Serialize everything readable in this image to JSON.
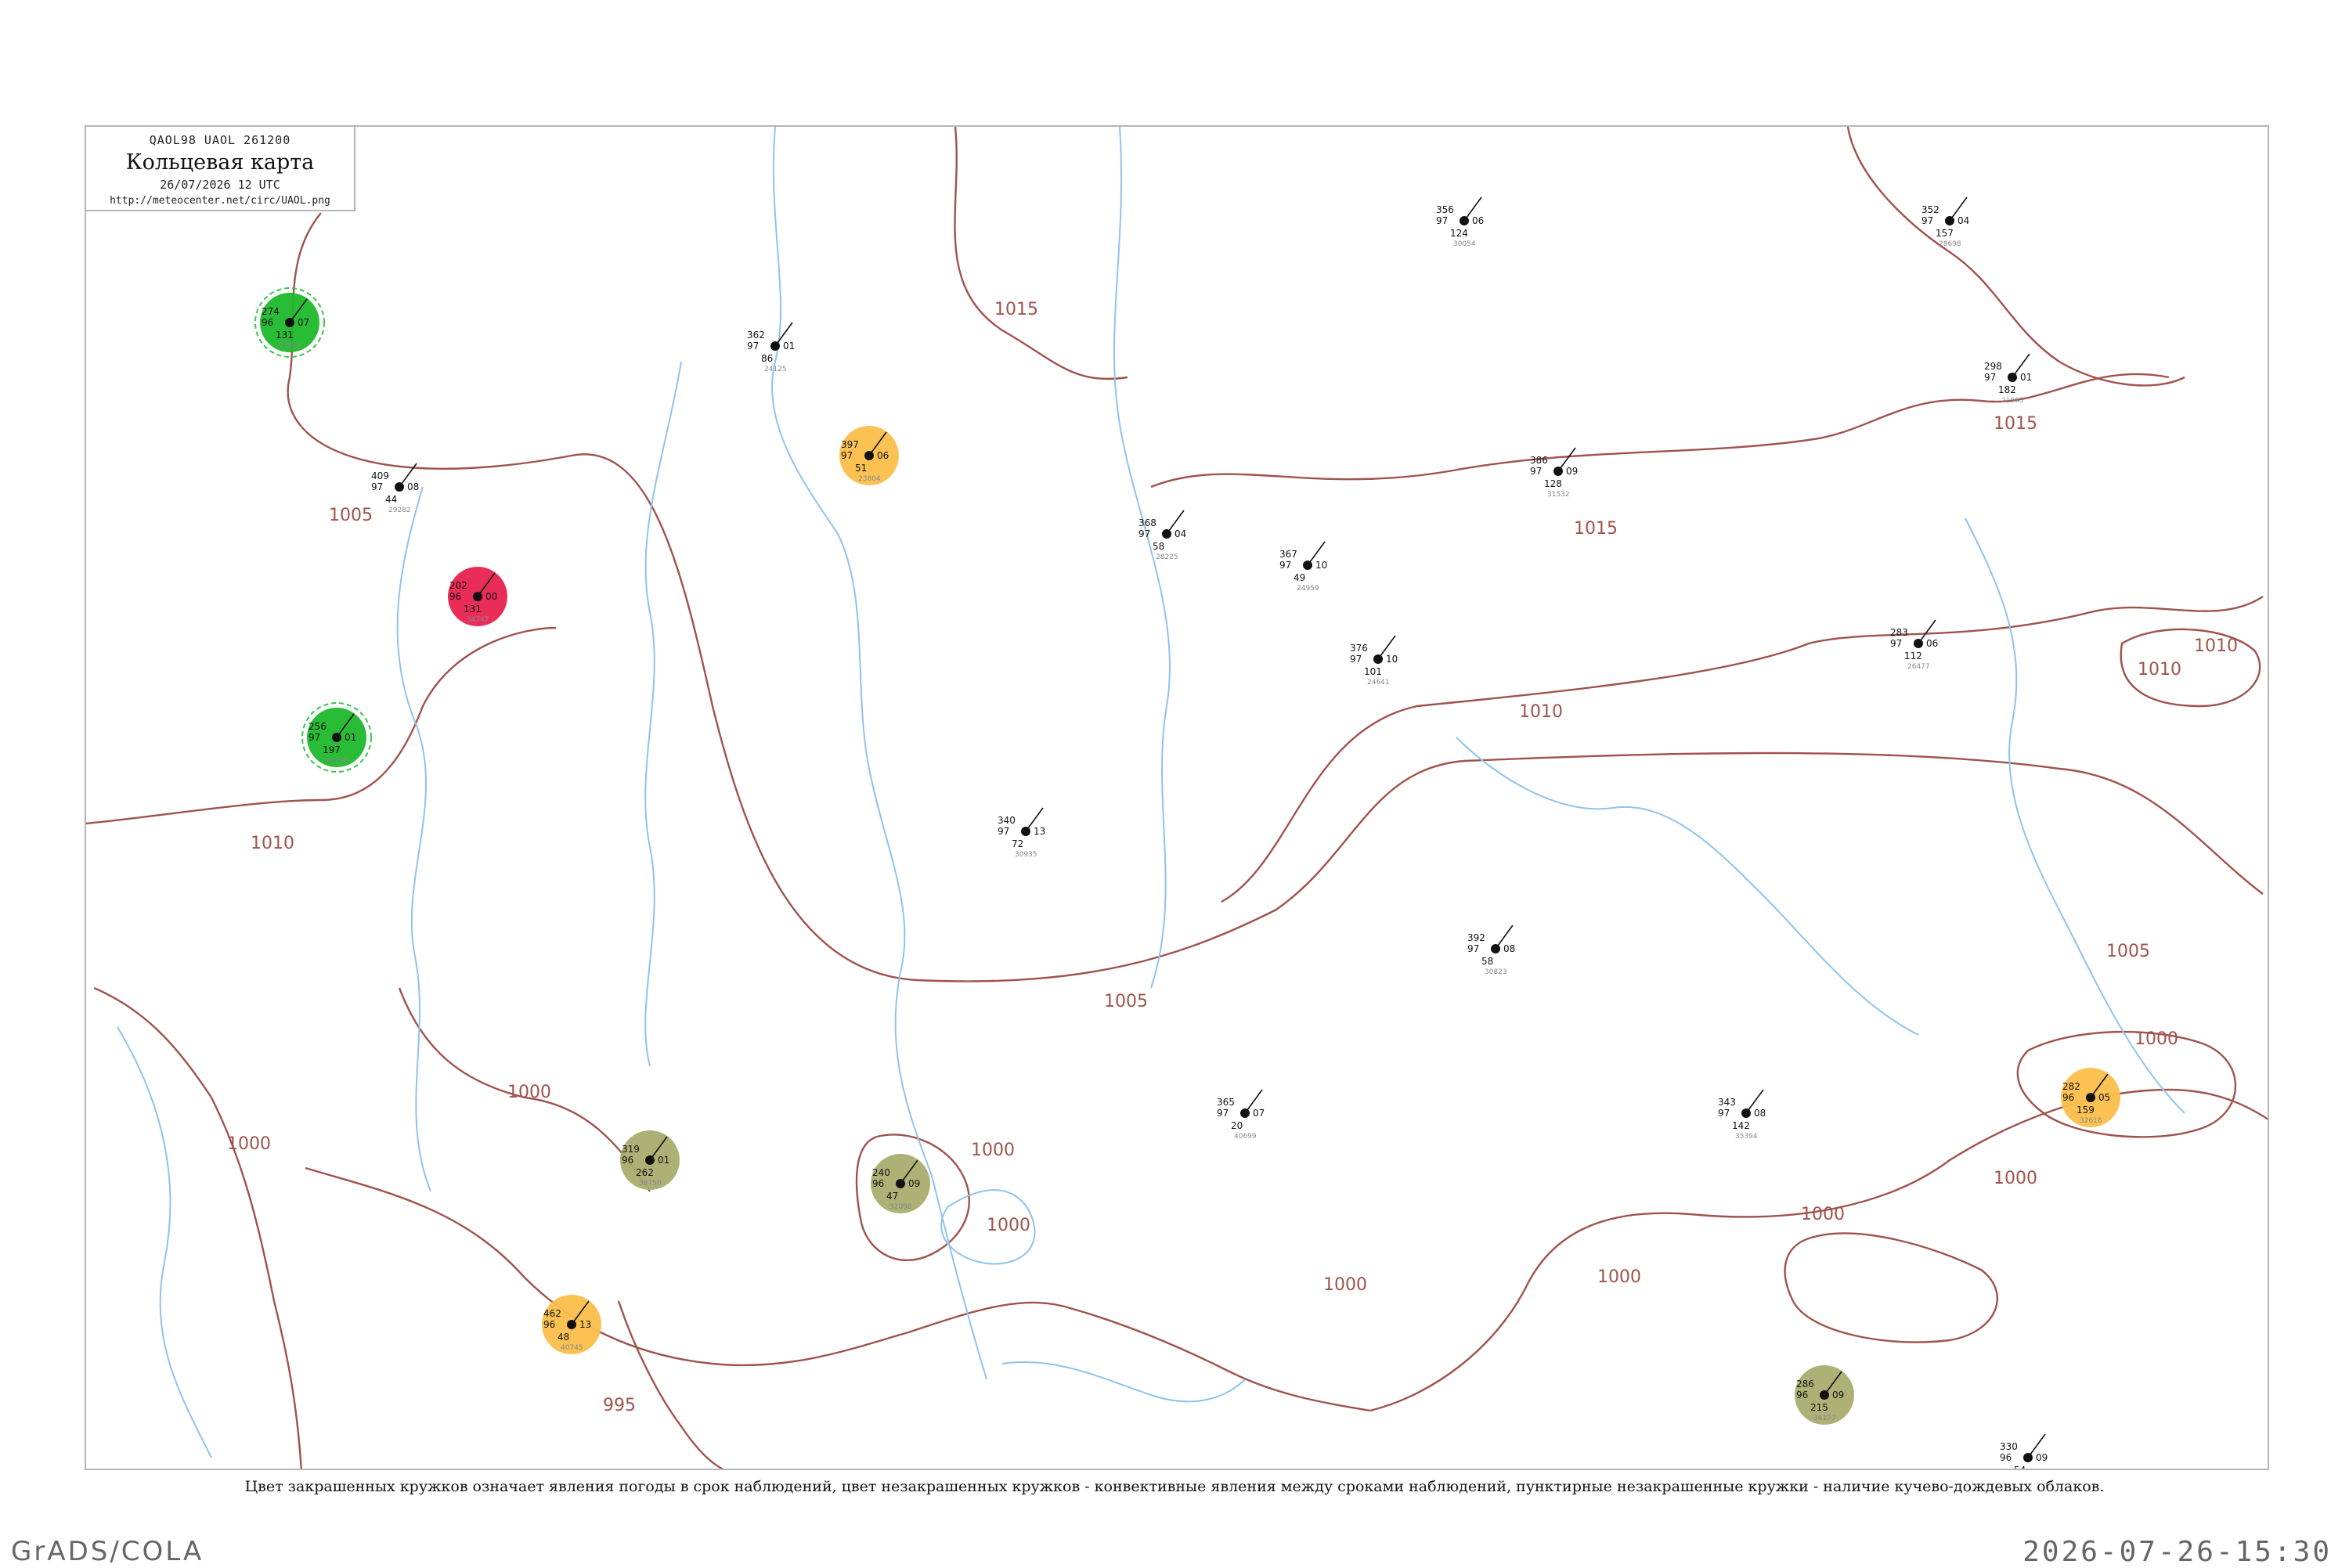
{
  "header": {
    "codes": "QAOL98  UAOL  261200",
    "title": "Кольцевая карта",
    "datetime": "26/07/2026 12 UTC",
    "url": "http://meteocenter.net/circ/UAOL.png"
  },
  "isobar_labels": {
    "label_995": "995",
    "label_1000": "1000",
    "label_1005": "1005",
    "label_1010": "1010",
    "label_1015": "1015"
  },
  "colors": {
    "isobar": "#a0524d",
    "river": "#8ec3ee",
    "circle_green": "#1db82b",
    "circle_red": "#e8224f",
    "circle_orange": "#fbbf4a",
    "circle_olive": "#a9ad6e",
    "circle_yellow": "#f2ef6a",
    "ring_green_dashed": "#34c74a",
    "ring_magenta": "#d43a86"
  },
  "map": {
    "stations": [
      {
        "id": "28225",
        "pressure": "368",
        "temp": "97",
        "value2": "04",
        "value3": "58",
        "highlight": "none"
      },
      {
        "id": "23804",
        "pressure": "397",
        "temp": "97",
        "value2": "06",
        "value3": "51",
        "highlight": "orange"
      },
      {
        "id": "24125",
        "pressure": "362",
        "temp": "97",
        "value2": "01",
        "value3": "86",
        "highlight": "none"
      },
      {
        "id": "30054",
        "pressure": "356",
        "temp": "97",
        "value2": "06",
        "value3": "124",
        "highlight": "none"
      },
      {
        "id": "29282",
        "pressure": "409",
        "temp": "97",
        "value2": "08",
        "value3": "44",
        "highlight": "none"
      },
      {
        "id": "31532",
        "pressure": "386",
        "temp": "97",
        "value2": "09",
        "value3": "128",
        "highlight": "none"
      },
      {
        "id": "28698",
        "pressure": "352",
        "temp": "97",
        "value2": "04",
        "value3": "157",
        "highlight": "none"
      },
      {
        "id": "32098",
        "pressure": "240",
        "temp": "96",
        "value2": "09",
        "value3": "47",
        "highlight": "olive"
      },
      {
        "id": "34747",
        "pressure": "202",
        "temp": "96",
        "value2": "00",
        "value3": "131",
        "highlight": "red"
      },
      {
        "id": "27612",
        "pressure": "274",
        "temp": "96",
        "value2": "07",
        "value3": "131",
        "highlight": "green"
      },
      {
        "id": "26477",
        "pressure": "283",
        "temp": "97",
        "value2": "06",
        "value3": "112",
        "highlight": "none"
      },
      {
        "id": "40745",
        "pressure": "462",
        "temp": "96",
        "value2": "13",
        "value3": "48",
        "highlight": "orange"
      },
      {
        "id": "38750",
        "pressure": "319",
        "temp": "96",
        "value2": "01",
        "value3": "262",
        "highlight": "olive"
      },
      {
        "id": "30935",
        "pressure": "340",
        "temp": "97",
        "value2": "13",
        "value3": "72",
        "highlight": "none"
      },
      {
        "id": "21965",
        "pressure": "298",
        "temp": "97",
        "value2": "01",
        "value3": "182",
        "highlight": "none"
      },
      {
        "id": "35746",
        "pressure": "330",
        "temp": "96",
        "value2": "09",
        "value3": "54",
        "highlight": "none"
      },
      {
        "id": "24959",
        "pressure": "367",
        "temp": "97",
        "value2": "10",
        "value3": "49",
        "highlight": "none"
      },
      {
        "id": "30823",
        "pressure": "392",
        "temp": "97",
        "value2": "08",
        "value3": "58",
        "highlight": "none"
      },
      {
        "id": "40699",
        "pressure": "365",
        "temp": "97",
        "value2": "07",
        "value3": "20",
        "highlight": "none"
      },
      {
        "id": "36177",
        "pressure": "286",
        "temp": "96",
        "value2": "09",
        "value3": "215",
        "highlight": "olive"
      },
      {
        "id": "26298",
        "pressure": "256",
        "temp": "97",
        "value2": "01",
        "value3": "197",
        "highlight": "green"
      },
      {
        "id": "24641",
        "pressure": "376",
        "temp": "97",
        "value2": "10",
        "value3": "101",
        "highlight": "none"
      },
      {
        "id": "35394",
        "pressure": "343",
        "temp": "97",
        "value2": "08",
        "value3": "142",
        "highlight": "none"
      },
      {
        "id": "32618",
        "pressure": "282",
        "temp": "96",
        "value2": "05",
        "value3": "159",
        "highlight": "orange"
      }
    ]
  },
  "legend_note": "Цвет закрашенных кружков означает явления погоды в срок наблюдений, цвет незакрашенных кружков - конвективные явления между сроками наблюдений, пунктирные незакрашенные кружки - наличие кучево-дождевых облаков.",
  "footer": {
    "brand": "GrADS/COLA",
    "timestamp": "2026-07-26-15:30"
  }
}
